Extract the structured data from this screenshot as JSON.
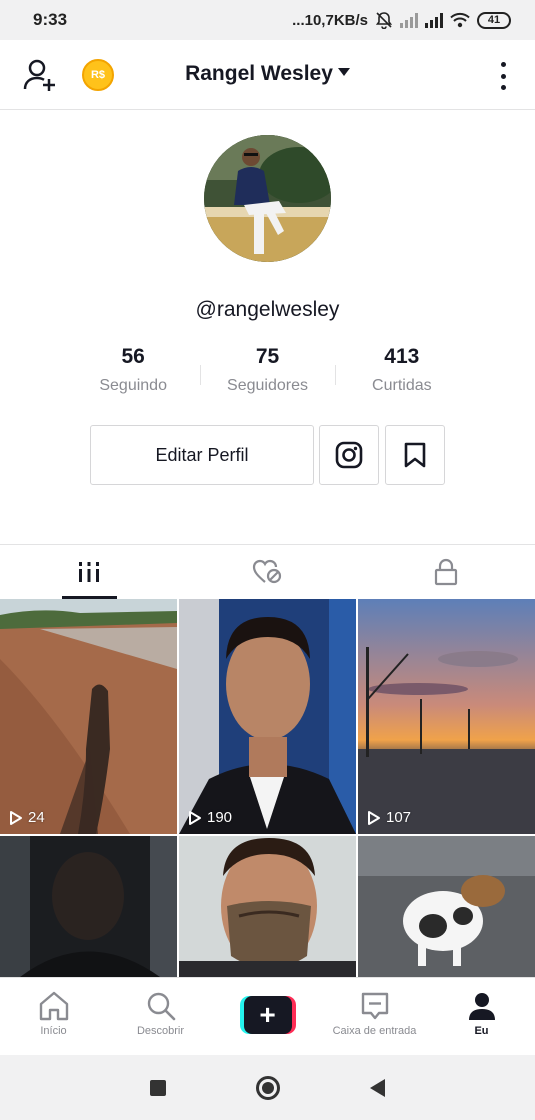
{
  "status_bar": {
    "time": "9:33",
    "network_speed": "...10,7KB/s",
    "battery": "41",
    "icons": [
      "mute-icon",
      "signal-icon",
      "signal-icon",
      "wifi-icon",
      "battery-icon"
    ]
  },
  "header": {
    "title": "Rangel Wesley",
    "left_icons": [
      "add-user-icon",
      "coin-icon"
    ],
    "coin_label": "R$",
    "right_icon": "more-vertical-icon"
  },
  "profile": {
    "handle": "@rangelwesley",
    "stats": [
      {
        "value": "56",
        "label": "Seguindo"
      },
      {
        "value": "75",
        "label": "Seguidores"
      },
      {
        "value": "413",
        "label": "Curtidas"
      }
    ],
    "edit_button": "Editar Perfil",
    "action_icons": [
      "instagram-icon",
      "bookmark-icon"
    ]
  },
  "tabs": [
    {
      "icon": "grid-icon",
      "active": true
    },
    {
      "icon": "liked-hidden-icon",
      "active": false
    },
    {
      "icon": "lock-icon",
      "active": false
    }
  ],
  "videos": [
    {
      "views": "24"
    },
    {
      "views": "190"
    },
    {
      "views": "107"
    },
    {
      "views": ""
    },
    {
      "views": ""
    },
    {
      "views": ""
    }
  ],
  "bottom_nav": [
    {
      "label": "Início",
      "icon": "home-icon"
    },
    {
      "label": "Descobrir",
      "icon": "search-icon"
    },
    {
      "label": "",
      "icon": "create-icon"
    },
    {
      "label": "Caixa de entrada",
      "icon": "inbox-icon"
    },
    {
      "label": "Eu",
      "icon": "profile-icon",
      "active": true
    }
  ],
  "colors": {
    "text": "#161823",
    "muted": "#8a8b91",
    "border": "#e3e3e4",
    "accent_cyan": "#25f4ee",
    "accent_red": "#fe2c55",
    "coin": "#ffc21a"
  }
}
